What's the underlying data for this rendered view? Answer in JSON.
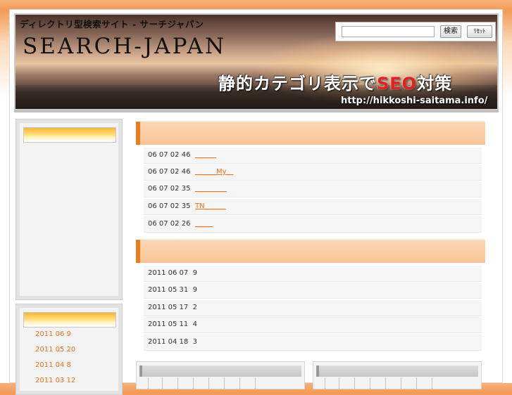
{
  "header": {
    "tagline": "ディレクトリ型検索サイト - サーチジャパン",
    "logo": "SEARCH-JAPAN",
    "search": {
      "value": "",
      "placeholder": "",
      "search_button": "検索",
      "reset_button": "ﾘｾｯﾄ"
    },
    "slogan_before": "静的カテゴリ表示で",
    "slogan_highlight": "SEO",
    "slogan_after": "対策",
    "site_url": "http://hikkoshi-saitama.info/"
  },
  "sidebar": {
    "archives": [
      {
        "label": "2011 06 9"
      },
      {
        "label": "2011 05 20"
      },
      {
        "label": "2011 04 8"
      },
      {
        "label": "2011 03 12"
      }
    ]
  },
  "main": {
    "recent_entries": [
      {
        "date": "06 07 02 46",
        "link": "______"
      },
      {
        "date": "06 07 02 46",
        "link": "______My__"
      },
      {
        "date": "06 07 02 35",
        "link": "_________"
      },
      {
        "date": "06 07 02 35",
        "link": "TN______"
      },
      {
        "date": "06 07 02 26",
        "link": "_____"
      }
    ],
    "daily_counts": [
      {
        "date": "2011 06 07",
        "count": "9"
      },
      {
        "date": "2011 05 31",
        "count": "9"
      },
      {
        "date": "2011 05 17",
        "count": "2"
      },
      {
        "date": "2011 05 11",
        "count": "4"
      },
      {
        "date": "2011 04 18",
        "count": "3"
      }
    ]
  },
  "colors": {
    "accent_orange": "#f07a18",
    "link_orange": "#e8731a",
    "seo_red": "#e61e1e"
  }
}
